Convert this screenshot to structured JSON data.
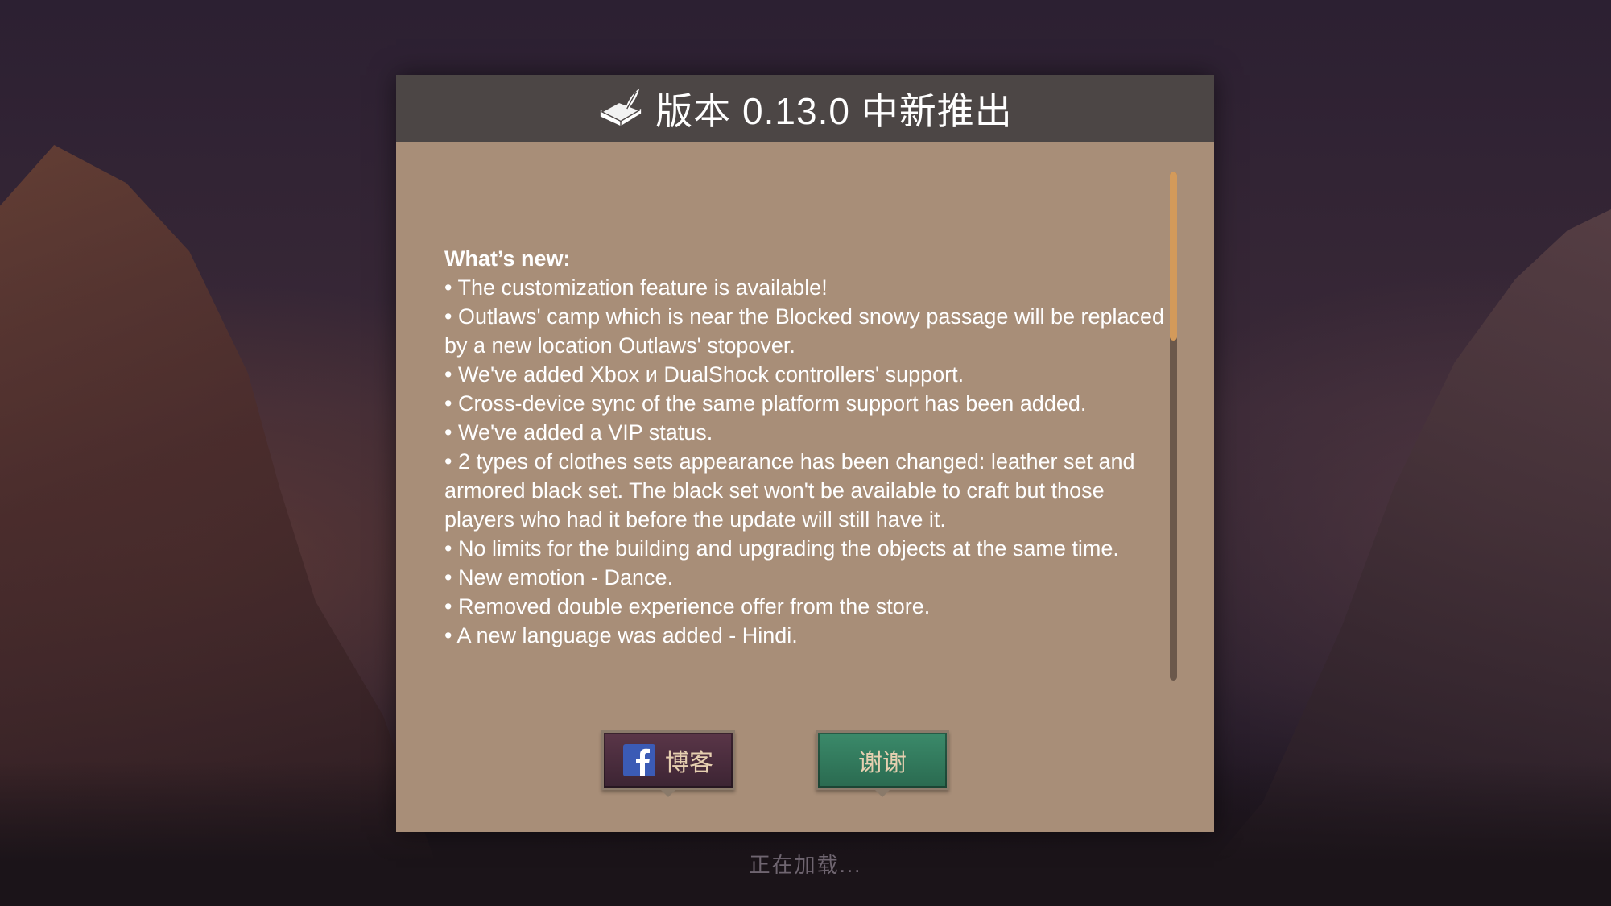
{
  "dialog": {
    "title": "版本 0.13.0 中新推出",
    "icon": "book-quill-icon",
    "heading": "What’s new:",
    "items": [
      "• The customization feature is available!",
      "• Outlaws' camp which is near the Blocked snowy passage will be replaced by a new location Outlaws' stopover.",
      "• We've added Xbox и DualShock controllers' support.",
      "• Cross-device sync of the same platform support has been added.",
      "• We've added a VIP status.",
      "• 2 types of clothes sets appearance has been changed: leather set and armored black set. The black set won't be available to craft but those players who had it before the update will still have it.",
      "• No limits for the building and upgrading the objects at the same time.",
      "• New emotion - Dance.",
      "• Removed double experience offer from the store.",
      "• A new language was added - Hindi."
    ],
    "buttons": {
      "blog_label": "博客",
      "blog_icon": "facebook-icon",
      "thanks_label": "谢谢"
    }
  },
  "loading_text": "正在加载...",
  "colors": {
    "panel": "#a88e78",
    "header": "#4c4645",
    "scroll_thumb": "#d39a5a",
    "blog_button": "#4a2c3c",
    "thanks_button": "#3b8a6a"
  }
}
